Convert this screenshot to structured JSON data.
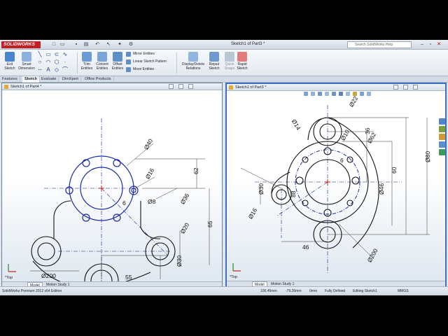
{
  "app": {
    "logo": "SOLIDWORKS",
    "document_title": "Sketch1 of Part3 *",
    "help_search_placeholder": "Search SolidWorks Help"
  },
  "ribbon": {
    "exit_sketch": "Exit Sketch",
    "smart_dimension": "Smart Dimension",
    "trim_entities": "Trim Entities",
    "convert_entities": "Convert Entities",
    "offset_entities": "Offset Entities",
    "mirror_entities": "Mirror Entities",
    "linear_sketch_pattern": "Linear Sketch Pattern",
    "move_entities": "Move Entities",
    "display_delete_relations": "Display/Delete Relations",
    "repair_sketch": "Repair Sketch",
    "quick_snaps": "Quick Snaps",
    "rapid_sketch": "Rapid Sketch"
  },
  "command_tabs": [
    "Features",
    "Sketch",
    "Evaluate",
    "DimXpert",
    "Office Products"
  ],
  "active_command_tab": "Sketch",
  "left_view": {
    "title": "Sketch1 of Part4 *",
    "orientation": "*Top",
    "tabs": [
      "Model",
      "Motion Study 1"
    ],
    "dims": {
      "d40": "Ø40",
      "d16": "Ø16",
      "d62": "62",
      "d6": "6",
      "d8": "Ø8",
      "d36": "Ø36",
      "d65": "65",
      "d20": "Ø20",
      "d30": "Ø30",
      "d200": "Ø200",
      "d55": "55"
    }
  },
  "right_view": {
    "title": "Sketch1 of Part3 *",
    "orientation": "*Top",
    "tabs": [
      "Model",
      "Motion Study 1"
    ],
    "dims": {
      "d22": "Ø22",
      "d36": "36",
      "d14": "Ø14",
      "d10": "Ø10",
      "d62": "Ø62",
      "d6": "6",
      "d80": "Ø80",
      "d60": "60",
      "d30": "Ø30",
      "d88": "88",
      "d46": "Ø46",
      "d16": "Ø16",
      "d46b": "46",
      "d200": "Ø200"
    }
  },
  "status": {
    "edition": "SolidWorks Premium 2012 x64 Edition",
    "x": "100.45mm",
    "y": "-79.26mm",
    "z": "0mm",
    "state": "Fully Defined",
    "mode": "Editing Sketch1",
    "units": "MMGS"
  }
}
